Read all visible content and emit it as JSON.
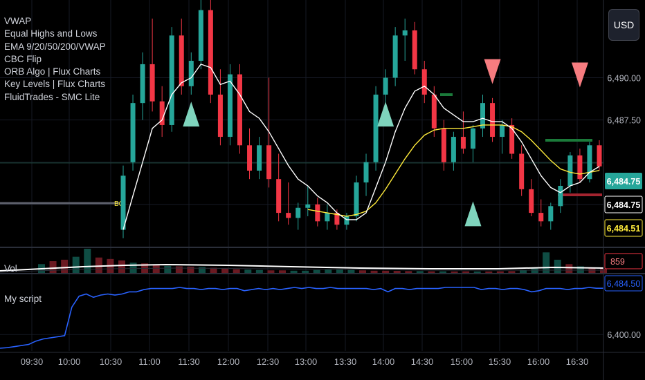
{
  "currency_button": "USD",
  "indicators": [
    "VWAP",
    "Equal Highs and Lows",
    "EMA 9/20/50/200/VWAP",
    "CBC Flip",
    "ORB Algo | Flux Charts",
    "Key Levels | Flux Charts",
    "FluidTrades - SMC Lite"
  ],
  "volume_pane": {
    "label": "Vol",
    "last_value_label": "859"
  },
  "script_pane": {
    "label": "My script",
    "last_value_label": "6,484.50"
  },
  "colors": {
    "up": "#26a69a",
    "down": "#f23645",
    "ema_fast": "#ffffff",
    "ema_slow": "#ffeb3b",
    "script_line": "#2962ff",
    "triangle_up": "#7fd4bd",
    "triangle_down": "#f77c80",
    "background": "#000000"
  },
  "price_axis": {
    "ticks": [
      {
        "value": 6490.0,
        "label": "6,490.00"
      },
      {
        "value": 6487.5,
        "label": "6,487.50"
      }
    ]
  },
  "price_labels": [
    {
      "value": 6484.75,
      "label": "6,484.75",
      "style": "last-green"
    },
    {
      "value": 6484.75,
      "label": "6,484.75",
      "style": "white"
    },
    {
      "value": 6484.51,
      "label": "6,484.51",
      "style": "yellow"
    }
  ],
  "script_axis": {
    "ticks": [
      {
        "value": 6400.0,
        "label": "6,400.00"
      }
    ]
  },
  "time_axis": {
    "labels": [
      "09:30",
      "10:00",
      "10:30",
      "11:00",
      "11:30",
      "12:00",
      "12:30",
      "13:00",
      "13:30",
      "14:00",
      "14:30",
      "15:00",
      "15:30",
      "16:00",
      "16:30"
    ]
  },
  "orb_label": "BO",
  "chart_data": {
    "type": "candlestick",
    "x_label_times": [
      "09:30",
      "10:00",
      "10:30",
      "11:00",
      "11:30",
      "12:00",
      "12:30",
      "13:00",
      "13:30",
      "14:00",
      "14:30",
      "15:00",
      "15:30",
      "16:00",
      "16:30"
    ],
    "price_ylim": [
      6481.5,
      6493.5
    ],
    "candles": [
      {
        "o": 6481.0,
        "h": 6484.8,
        "l": 6480.5,
        "c": 6484.2
      },
      {
        "o": 6485.0,
        "h": 6489.0,
        "l": 6484.5,
        "c": 6488.5
      },
      {
        "o": 6488.5,
        "h": 6491.5,
        "l": 6487.5,
        "c": 6490.8
      },
      {
        "o": 6490.8,
        "h": 6493.5,
        "l": 6488.0,
        "c": 6488.6
      },
      {
        "o": 6488.6,
        "h": 6489.5,
        "l": 6486.5,
        "c": 6487.2
      },
      {
        "o": 6487.2,
        "h": 6493.0,
        "l": 6486.8,
        "c": 6492.5
      },
      {
        "o": 6492.5,
        "h": 6493.5,
        "l": 6489.0,
        "c": 6489.5
      },
      {
        "o": 6489.5,
        "h": 6491.5,
        "l": 6489.0,
        "c": 6491.0
      },
      {
        "o": 6491.0,
        "h": 6495.0,
        "l": 6490.5,
        "c": 6494.0
      },
      {
        "o": 6494.0,
        "h": 6495.0,
        "l": 6488.5,
        "c": 6489.0
      },
      {
        "o": 6489.0,
        "h": 6490.5,
        "l": 6486.0,
        "c": 6486.5
      },
      {
        "o": 6486.5,
        "h": 6490.8,
        "l": 6486.0,
        "c": 6490.2
      },
      {
        "o": 6490.2,
        "h": 6490.8,
        "l": 6485.5,
        "c": 6486.0
      },
      {
        "o": 6486.0,
        "h": 6487.0,
        "l": 6484.0,
        "c": 6484.5
      },
      {
        "o": 6484.5,
        "h": 6486.5,
        "l": 6484.0,
        "c": 6486.0
      },
      {
        "o": 6486.0,
        "h": 6490.0,
        "l": 6483.5,
        "c": 6484.0
      },
      {
        "o": 6484.0,
        "h": 6485.5,
        "l": 6481.5,
        "c": 6482.0
      },
      {
        "o": 6482.0,
        "h": 6483.8,
        "l": 6481.3,
        "c": 6481.7
      },
      {
        "o": 6481.7,
        "h": 6482.6,
        "l": 6481.0,
        "c": 6482.3
      },
      {
        "o": 6482.3,
        "h": 6483.6,
        "l": 6481.8,
        "c": 6482.5
      },
      {
        "o": 6482.5,
        "h": 6482.9,
        "l": 6481.2,
        "c": 6481.5
      },
      {
        "o": 6481.5,
        "h": 6482.5,
        "l": 6481.0,
        "c": 6482.0
      },
      {
        "o": 6482.0,
        "h": 6482.2,
        "l": 6481.0,
        "c": 6481.3
      },
      {
        "o": 6481.3,
        "h": 6482.0,
        "l": 6481.0,
        "c": 6481.8
      },
      {
        "o": 6481.8,
        "h": 6484.2,
        "l": 6481.5,
        "c": 6483.8
      },
      {
        "o": 6483.8,
        "h": 6485.5,
        "l": 6483.0,
        "c": 6485.0
      },
      {
        "o": 6485.0,
        "h": 6489.5,
        "l": 6484.5,
        "c": 6489.0
      },
      {
        "o": 6489.0,
        "h": 6490.5,
        "l": 6488.0,
        "c": 6490.0
      },
      {
        "o": 6490.0,
        "h": 6493.0,
        "l": 6489.5,
        "c": 6492.5
      },
      {
        "o": 6492.5,
        "h": 6493.5,
        "l": 6491.0,
        "c": 6492.8
      },
      {
        "o": 6492.8,
        "h": 6493.3,
        "l": 6490.2,
        "c": 6490.5
      },
      {
        "o": 6490.5,
        "h": 6491.0,
        "l": 6488.5,
        "c": 6489.0
      },
      {
        "o": 6489.0,
        "h": 6489.5,
        "l": 6486.5,
        "c": 6487.0
      },
      {
        "o": 6487.0,
        "h": 6487.5,
        "l": 6484.5,
        "c": 6485.0
      },
      {
        "o": 6485.0,
        "h": 6486.8,
        "l": 6484.5,
        "c": 6486.5
      },
      {
        "o": 6486.5,
        "h": 6488.0,
        "l": 6485.5,
        "c": 6485.8
      },
      {
        "o": 6485.8,
        "h": 6487.2,
        "l": 6485.0,
        "c": 6487.0
      },
      {
        "o": 6487.0,
        "h": 6489.0,
        "l": 6486.5,
        "c": 6488.5
      },
      {
        "o": 6488.5,
        "h": 6488.8,
        "l": 6486.2,
        "c": 6486.5
      },
      {
        "o": 6486.5,
        "h": 6487.5,
        "l": 6485.5,
        "c": 6487.2
      },
      {
        "o": 6487.2,
        "h": 6487.6,
        "l": 6485.2,
        "c": 6485.5
      },
      {
        "o": 6485.5,
        "h": 6486.0,
        "l": 6483.0,
        "c": 6483.4
      },
      {
        "o": 6483.4,
        "h": 6484.0,
        "l": 6481.8,
        "c": 6482.0
      },
      {
        "o": 6482.0,
        "h": 6482.8,
        "l": 6481.2,
        "c": 6481.5
      },
      {
        "o": 6481.5,
        "h": 6482.6,
        "l": 6481.0,
        "c": 6482.4
      },
      {
        "o": 6482.4,
        "h": 6484.0,
        "l": 6482.0,
        "c": 6483.6
      },
      {
        "o": 6483.6,
        "h": 6485.6,
        "l": 6483.2,
        "c": 6485.4
      },
      {
        "o": 6485.4,
        "h": 6485.8,
        "l": 6483.8,
        "c": 6484.0
      },
      {
        "o": 6484.0,
        "h": 6486.2,
        "l": 6483.8,
        "c": 6486.0
      },
      {
        "o": 6486.0,
        "h": 6486.3,
        "l": 6484.5,
        "c": 6484.75
      }
    ],
    "ema_fast": [
      6481.0,
      6483.0,
      6485.0,
      6487.0,
      6487.5,
      6489.0,
      6489.7,
      6490.0,
      6490.8,
      6490.6,
      6489.6,
      6489.8,
      6489.0,
      6488.0,
      6487.6,
      6486.8,
      6485.8,
      6484.8,
      6484.0,
      6483.6,
      6483.0,
      6482.6,
      6482.0,
      6481.6,
      6481.6,
      6482.0,
      6483.5,
      6485.0,
      6486.8,
      6488.2,
      6489.2,
      6489.5,
      6489.0,
      6488.2,
      6487.8,
      6487.4,
      6487.4,
      6487.6,
      6487.4,
      6487.4,
      6487.0,
      6486.2,
      6485.2,
      6484.2,
      6483.5,
      6483.2,
      6483.6,
      6483.8,
      6484.4,
      6484.75
    ],
    "ema_slow": [
      null,
      null,
      null,
      null,
      null,
      null,
      null,
      null,
      null,
      null,
      null,
      null,
      null,
      null,
      null,
      null,
      null,
      null,
      null,
      6482.2,
      6482.1,
      6482.0,
      6481.9,
      6481.8,
      6481.9,
      6482.1,
      6482.6,
      6483.4,
      6484.3,
      6485.2,
      6486.0,
      6486.6,
      6486.9,
      6487.0,
      6487.0,
      6487.0,
      6487.1,
      6487.2,
      6487.2,
      6487.2,
      6487.1,
      6486.8,
      6486.3,
      6485.7,
      6485.1,
      6484.6,
      6484.4,
      6484.3,
      6484.4,
      6484.51
    ],
    "triangles_up": [
      {
        "bar": 7,
        "price": 6487.6
      },
      {
        "bar": 27,
        "price": 6487.6
      },
      {
        "bar": 36,
        "price": 6481.7
      }
    ],
    "triangles_down": [
      {
        "bar": 38,
        "price": 6490.2
      },
      {
        "bar": 47,
        "price": 6490.0
      }
    ],
    "volume": [
      {
        "v": 120,
        "up": true
      },
      {
        "v": 160,
        "up": false
      },
      {
        "v": 180,
        "up": false
      },
      {
        "v": 220,
        "up": true
      },
      {
        "v": 330,
        "up": true
      },
      {
        "v": 210,
        "up": false
      },
      {
        "v": 190,
        "up": false
      },
      {
        "v": 170,
        "up": false
      },
      {
        "v": 140,
        "up": true
      },
      {
        "v": 130,
        "up": false
      },
      {
        "v": 110,
        "up": false
      },
      {
        "v": 95,
        "up": true
      },
      {
        "v": 90,
        "up": false
      },
      {
        "v": 85,
        "up": false
      },
      {
        "v": 80,
        "up": true
      },
      {
        "v": 70,
        "up": false
      },
      {
        "v": 60,
        "up": false
      },
      {
        "v": 50,
        "up": false
      },
      {
        "v": 45,
        "up": true
      },
      {
        "v": 40,
        "up": true
      },
      {
        "v": 35,
        "up": false
      },
      {
        "v": 35,
        "up": false
      },
      {
        "v": 30,
        "up": true
      },
      {
        "v": 30,
        "up": true
      },
      {
        "v": 40,
        "up": true
      },
      {
        "v": 45,
        "up": true
      },
      {
        "v": 50,
        "up": true
      },
      {
        "v": 40,
        "up": true
      },
      {
        "v": 35,
        "up": false
      },
      {
        "v": 30,
        "up": false
      },
      {
        "v": 30,
        "up": false
      },
      {
        "v": 28,
        "up": false
      },
      {
        "v": 25,
        "up": false
      },
      {
        "v": 25,
        "up": true
      },
      {
        "v": 22,
        "up": false
      },
      {
        "v": 22,
        "up": true
      },
      {
        "v": 20,
        "up": false
      },
      {
        "v": 22,
        "up": false
      },
      {
        "v": 20,
        "up": true
      },
      {
        "v": 20,
        "up": false
      },
      {
        "v": 22,
        "up": false
      },
      {
        "v": 25,
        "up": false
      },
      {
        "v": 40,
        "up": true
      },
      {
        "v": 60,
        "up": true
      },
      {
        "v": 280,
        "up": true
      },
      {
        "v": 180,
        "up": true
      },
      {
        "v": 120,
        "up": false
      },
      {
        "v": 90,
        "up": true
      },
      {
        "v": 70,
        "up": false
      },
      {
        "v": 60,
        "up": false
      }
    ],
    "script_ylim": [
      6370,
      6510
    ],
    "script_line": [
      6375,
      6376,
      6378,
      6380,
      6382,
      6388,
      6392,
      6394,
      6396,
      6398,
      6450,
      6470,
      6474,
      6468,
      6472,
      6474,
      6472,
      6474,
      6478,
      6478,
      6482,
      6484,
      6484,
      6484,
      6484,
      6486,
      6484,
      6484,
      6482,
      6484,
      6484,
      6482,
      6484,
      6484,
      6480,
      6482,
      6484,
      6482,
      6484,
      6482,
      6484,
      6486,
      6484,
      6486,
      6484,
      6484,
      6486,
      6484,
      6484,
      6484,
      6484,
      6484,
      6482,
      6484,
      6478,
      6484,
      6484,
      6482,
      6484,
      6484,
      6484,
      6484,
      6486,
      6486,
      6486,
      6486,
      6486,
      6482,
      6484,
      6484,
      6482,
      6484,
      6484,
      6482,
      6478,
      6480,
      6484,
      6484,
      6484,
      6482,
      6484,
      6484,
      6486,
      6484.5,
      6484.5
    ]
  }
}
